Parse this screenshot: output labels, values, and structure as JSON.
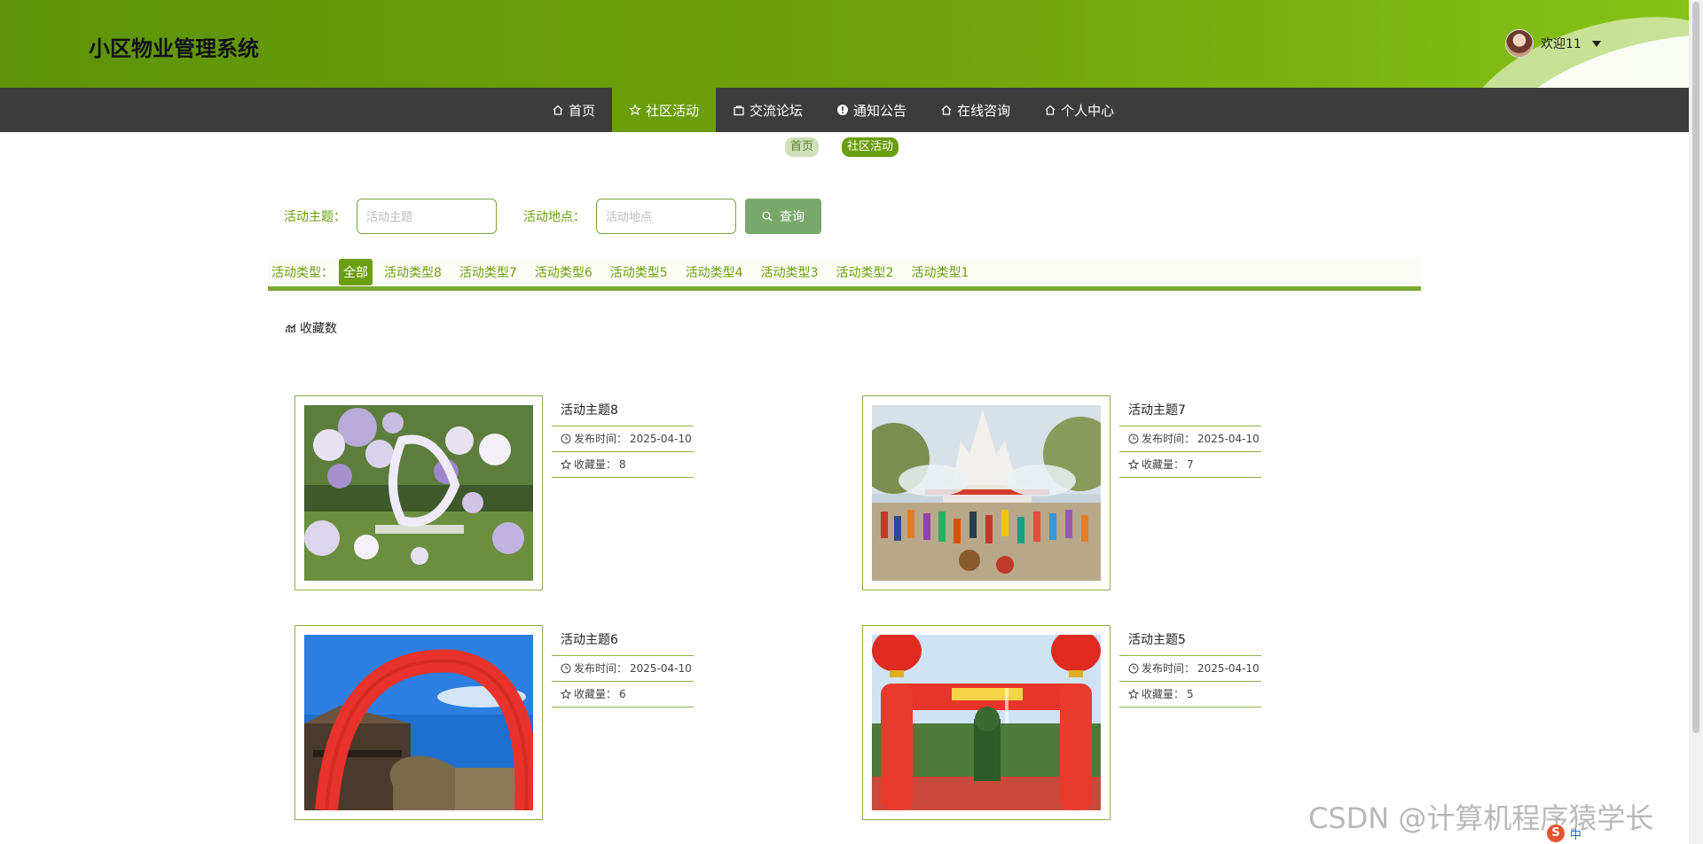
{
  "header": {
    "app_title": "小区物业管理系统",
    "welcome": "欢迎11"
  },
  "nav": {
    "items": [
      {
        "label": "首页",
        "icon": "home-icon"
      },
      {
        "label": "社区活动",
        "icon": "star-icon",
        "active": true
      },
      {
        "label": "交流论坛",
        "icon": "bag-icon"
      },
      {
        "label": "通知公告",
        "icon": "alert-icon"
      },
      {
        "label": "在线咨询",
        "icon": "home-icon"
      },
      {
        "label": "个人中心",
        "icon": "home-icon"
      }
    ]
  },
  "breadcrumb": {
    "home": "首页",
    "current": "社区活动"
  },
  "search": {
    "theme_label": "活动主题：",
    "theme_placeholder": "活动主题",
    "location_label": "活动地点：",
    "location_placeholder": "活动地点",
    "query_button": "查询"
  },
  "types": {
    "label": "活动类型：",
    "items": [
      "全部",
      "活动类型8",
      "活动类型7",
      "活动类型6",
      "活动类型5",
      "活动类型4",
      "活动类型3",
      "活动类型2",
      "活动类型1"
    ]
  },
  "sort": {
    "label": "收藏数",
    "icon": "chart-icon"
  },
  "activities": [
    {
      "title": "活动主题8",
      "publish_label": "发布时间：",
      "publish_date": "2025-04-10",
      "fav_label": "收藏量：",
      "favorites": "8"
    },
    {
      "title": "活动主题7",
      "publish_label": "发布时间：",
      "publish_date": "2025-04-10",
      "fav_label": "收藏量：",
      "favorites": "7"
    },
    {
      "title": "活动主题6",
      "publish_label": "发布时间：",
      "publish_date": "2025-04-10",
      "fav_label": "收藏量：",
      "favorites": "6"
    },
    {
      "title": "活动主题5",
      "publish_label": "发布时间：",
      "publish_date": "2025-04-10",
      "fav_label": "收藏量：",
      "favorites": "5"
    }
  ],
  "watermark": "CSDN @计算机程序猿学长",
  "ime": {
    "logo": "S",
    "lang": "中"
  },
  "colors": {
    "brand": "#6a9e0a",
    "nav_bg": "#3c3c3c",
    "card_border": "#8ab04a"
  }
}
